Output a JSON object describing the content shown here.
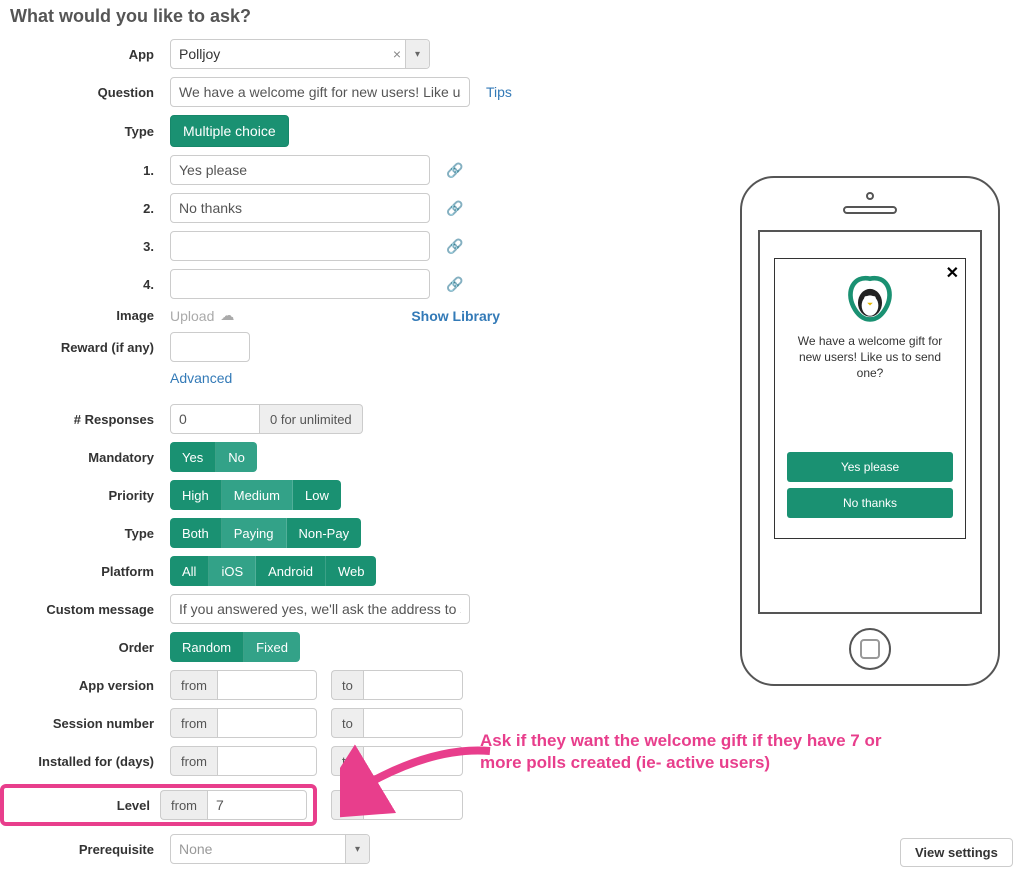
{
  "title": "What would you like to ask?",
  "form": {
    "app_label": "App",
    "app_value": "Polljoy",
    "question_label": "Question",
    "question_value": "We have a welcome gift for new users! Like us to send one?",
    "tips": "Tips",
    "type_label": "Type",
    "type_button": "Multiple choice",
    "choices": {
      "n1": "1.",
      "v1": "Yes please",
      "n2": "2.",
      "v2": "No thanks",
      "n3": "3.",
      "v3": "",
      "n4": "4.",
      "v4": ""
    },
    "image_label": "Image",
    "upload": "Upload",
    "show_library": "Show Library",
    "reward_label": "Reward (if any)",
    "advanced": "Advanced",
    "responses_label": "# Responses",
    "responses_value": "0",
    "responses_hint": "0 for unlimited",
    "mandatory_label": "Mandatory",
    "mandatory_yes": "Yes",
    "mandatory_no": "No",
    "priority_label": "Priority",
    "priority_high": "High",
    "priority_med": "Medium",
    "priority_low": "Low",
    "paytype_label": "Type",
    "paytype_both": "Both",
    "paytype_paying": "Paying",
    "paytype_nonpay": "Non-Pay",
    "platform_label": "Platform",
    "platform_all": "All",
    "platform_ios": "iOS",
    "platform_android": "Android",
    "platform_web": "Web",
    "custom_msg_label": "Custom message",
    "custom_msg_value": "If you answered yes, we'll ask the address to send",
    "order_label": "Order",
    "order_random": "Random",
    "order_fixed": "Fixed",
    "appver_label": "App version",
    "session_label": "Session number",
    "installed_label": "Installed for (days)",
    "level_label": "Level",
    "level_from": "7",
    "prereq_label": "Prerequisite",
    "prereq_value": "None",
    "range_from": "from",
    "range_to": "to"
  },
  "annotation": "Ask if they want the welcome gift if they have 7 or more polls created (ie- active users)",
  "preview": {
    "msg": "We have a welcome gift for new users! Like us to send one?",
    "opt1": "Yes please",
    "opt2": "No thanks"
  },
  "view_settings": "View settings"
}
